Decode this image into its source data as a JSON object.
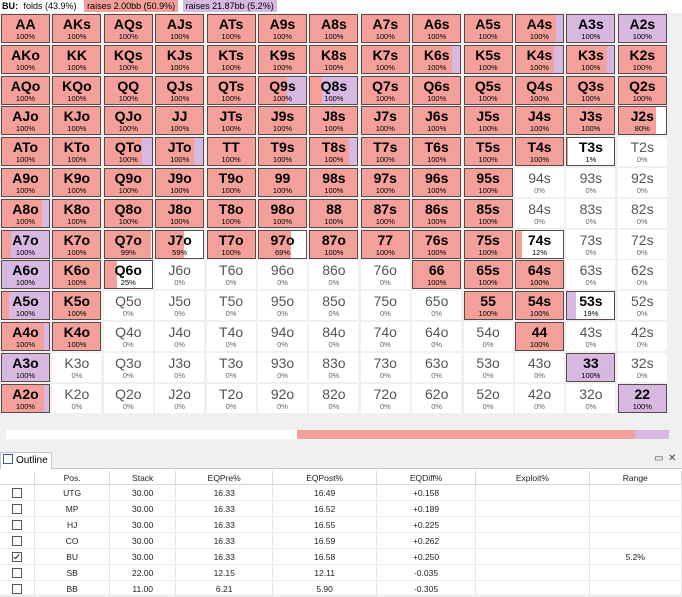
{
  "header": {
    "position": "BU:",
    "items": [
      {
        "label": "folds (43.9%)",
        "color": "#ffffff"
      },
      {
        "label": "raises 2.00bb (50.9%)",
        "color": "#f4a09a"
      },
      {
        "label": "raises 21.87bb (5.2%)",
        "color": "#d6b8e0"
      }
    ]
  },
  "colors": {
    "raise_small": "#f4a09a",
    "raise_allin": "#d6b8e0",
    "fold": "#ffffff"
  },
  "grid": [
    [
      {
        "c": "AA",
        "p": "100%",
        "r": 1,
        "a": 0
      },
      {
        "c": "AKs",
        "p": "100%",
        "r": 1,
        "a": 0
      },
      {
        "c": "AQs",
        "p": "100%",
        "r": 1,
        "a": 0
      },
      {
        "c": "AJs",
        "p": "100%",
        "r": 1,
        "a": 0
      },
      {
        "c": "ATs",
        "p": "100%",
        "r": 1,
        "a": 0
      },
      {
        "c": "A9s",
        "p": "100%",
        "r": 1,
        "a": 0
      },
      {
        "c": "A8s",
        "p": "100%",
        "r": 1,
        "a": 0
      },
      {
        "c": "A7s",
        "p": "100%",
        "r": 1,
        "a": 0
      },
      {
        "c": "A6s",
        "p": "100%",
        "r": 1,
        "a": 0
      },
      {
        "c": "A5s",
        "p": "100%",
        "r": 1,
        "a": 0
      },
      {
        "c": "A4s",
        "p": "100%",
        "r": 0.85,
        "a": 0.15
      },
      {
        "c": "A3s",
        "p": "100%",
        "r": 0,
        "a": 1
      },
      {
        "c": "A2s",
        "p": "100%",
        "r": 0,
        "a": 1
      }
    ],
    [
      {
        "c": "AKo",
        "p": "100%",
        "r": 1,
        "a": 0
      },
      {
        "c": "KK",
        "p": "100%",
        "r": 1,
        "a": 0
      },
      {
        "c": "KQs",
        "p": "100%",
        "r": 1,
        "a": 0
      },
      {
        "c": "KJs",
        "p": "100%",
        "r": 1,
        "a": 0
      },
      {
        "c": "KTs",
        "p": "100%",
        "r": 1,
        "a": 0
      },
      {
        "c": "K9s",
        "p": "100%",
        "r": 1,
        "a": 0
      },
      {
        "c": "K8s",
        "p": "100%",
        "r": 1,
        "a": 0
      },
      {
        "c": "K7s",
        "p": "100%",
        "r": 1,
        "a": 0
      },
      {
        "c": "K6s",
        "p": "100%",
        "r": 0.82,
        "a": 0.18
      },
      {
        "c": "K5s",
        "p": "100%",
        "r": 1,
        "a": 0
      },
      {
        "c": "K4s",
        "p": "100%",
        "r": 0.8,
        "a": 0.2
      },
      {
        "c": "K3s",
        "p": "100%",
        "r": 0.85,
        "a": 0.15
      },
      {
        "c": "K2s",
        "p": "100%",
        "r": 1,
        "a": 0
      }
    ],
    [
      {
        "c": "AQo",
        "p": "100%",
        "r": 1,
        "a": 0
      },
      {
        "c": "KQo",
        "p": "100%",
        "r": 1,
        "a": 0
      },
      {
        "c": "QQ",
        "p": "100%",
        "r": 1,
        "a": 0
      },
      {
        "c": "QJs",
        "p": "100%",
        "r": 1,
        "a": 0
      },
      {
        "c": "QTs",
        "p": "100%",
        "r": 1,
        "a": 0
      },
      {
        "c": "Q9s",
        "p": "100%",
        "r": 0.6,
        "a": 0.4
      },
      {
        "c": "Q8s",
        "p": "100%",
        "r": 0.25,
        "a": 0.75
      },
      {
        "c": "Q7s",
        "p": "100%",
        "r": 1,
        "a": 0
      },
      {
        "c": "Q6s",
        "p": "100%",
        "r": 1,
        "a": 0
      },
      {
        "c": "Q5s",
        "p": "100%",
        "r": 1,
        "a": 0
      },
      {
        "c": "Q4s",
        "p": "100%",
        "r": 1,
        "a": 0
      },
      {
        "c": "Q3s",
        "p": "100%",
        "r": 1,
        "a": 0
      },
      {
        "c": "Q2s",
        "p": "100%",
        "r": 1,
        "a": 0
      }
    ],
    [
      {
        "c": "AJo",
        "p": "100%",
        "r": 1,
        "a": 0
      },
      {
        "c": "KJo",
        "p": "100%",
        "r": 1,
        "a": 0
      },
      {
        "c": "QJo",
        "p": "100%",
        "r": 1,
        "a": 0
      },
      {
        "c": "JJ",
        "p": "100%",
        "r": 1,
        "a": 0
      },
      {
        "c": "JTs",
        "p": "100%",
        "r": 1,
        "a": 0
      },
      {
        "c": "J9s",
        "p": "100%",
        "r": 1,
        "a": 0
      },
      {
        "c": "J8s",
        "p": "100%",
        "r": 1,
        "a": 0
      },
      {
        "c": "J7s",
        "p": "100%",
        "r": 1,
        "a": 0
      },
      {
        "c": "J6s",
        "p": "100%",
        "r": 1,
        "a": 0
      },
      {
        "c": "J5s",
        "p": "100%",
        "r": 1,
        "a": 0
      },
      {
        "c": "J4s",
        "p": "100%",
        "r": 1,
        "a": 0
      },
      {
        "c": "J3s",
        "p": "100%",
        "r": 1,
        "a": 0
      },
      {
        "c": "J2s",
        "p": "80%",
        "r": 0.8,
        "a": 0
      }
    ],
    [
      {
        "c": "ATo",
        "p": "100%",
        "r": 1,
        "a": 0
      },
      {
        "c": "KTo",
        "p": "100%",
        "r": 1,
        "a": 0
      },
      {
        "c": "QTo",
        "p": "100%",
        "r": 0.8,
        "a": 0.2
      },
      {
        "c": "JTo",
        "p": "100%",
        "r": 0.8,
        "a": 0.2
      },
      {
        "c": "TT",
        "p": "100%",
        "r": 1,
        "a": 0
      },
      {
        "c": "T9s",
        "p": "100%",
        "r": 1,
        "a": 0
      },
      {
        "c": "T8s",
        "p": "100%",
        "r": 0.82,
        "a": 0.18
      },
      {
        "c": "T7s",
        "p": "100%",
        "r": 1,
        "a": 0
      },
      {
        "c": "T6s",
        "p": "100%",
        "r": 1,
        "a": 0
      },
      {
        "c": "T5s",
        "p": "100%",
        "r": 1,
        "a": 0
      },
      {
        "c": "T4s",
        "p": "100%",
        "r": 1,
        "a": 0
      },
      {
        "c": "T3s",
        "p": "1%",
        "r": 0.01,
        "a": 0
      },
      {
        "c": "T2s",
        "p": "0%",
        "r": 0,
        "a": 0
      }
    ],
    [
      {
        "c": "A9o",
        "p": "100%",
        "r": 1,
        "a": 0
      },
      {
        "c": "K9o",
        "p": "100%",
        "r": 1,
        "a": 0
      },
      {
        "c": "Q9o",
        "p": "100%",
        "r": 1,
        "a": 0
      },
      {
        "c": "J9o",
        "p": "100%",
        "r": 1,
        "a": 0
      },
      {
        "c": "T9o",
        "p": "100%",
        "r": 1,
        "a": 0
      },
      {
        "c": "99",
        "p": "100%",
        "r": 1,
        "a": 0
      },
      {
        "c": "98s",
        "p": "100%",
        "r": 1,
        "a": 0
      },
      {
        "c": "97s",
        "p": "100%",
        "r": 1,
        "a": 0
      },
      {
        "c": "96s",
        "p": "100%",
        "r": 1,
        "a": 0
      },
      {
        "c": "95s",
        "p": "100%",
        "r": 1,
        "a": 0
      },
      {
        "c": "94s",
        "p": "0%",
        "r": 0,
        "a": 0
      },
      {
        "c": "93s",
        "p": "0%",
        "r": 0,
        "a": 0
      },
      {
        "c": "92s",
        "p": "0%",
        "r": 0,
        "a": 0
      }
    ],
    [
      {
        "c": "A8o",
        "p": "100%",
        "r": 0.85,
        "a": 0.15
      },
      {
        "c": "K8o",
        "p": "100%",
        "r": 1,
        "a": 0
      },
      {
        "c": "Q8o",
        "p": "100%",
        "r": 1,
        "a": 0
      },
      {
        "c": "J8o",
        "p": "100%",
        "r": 1,
        "a": 0
      },
      {
        "c": "T8o",
        "p": "100%",
        "r": 1,
        "a": 0
      },
      {
        "c": "98o",
        "p": "100%",
        "r": 1,
        "a": 0
      },
      {
        "c": "88",
        "p": "100%",
        "r": 1,
        "a": 0
      },
      {
        "c": "87s",
        "p": "100%",
        "r": 1,
        "a": 0
      },
      {
        "c": "86s",
        "p": "100%",
        "r": 1,
        "a": 0
      },
      {
        "c": "85s",
        "p": "100%",
        "r": 1,
        "a": 0
      },
      {
        "c": "84s",
        "p": "0%",
        "r": 0,
        "a": 0
      },
      {
        "c": "83s",
        "p": "0%",
        "r": 0,
        "a": 0
      },
      {
        "c": "82s",
        "p": "0%",
        "r": 0,
        "a": 0
      }
    ],
    [
      {
        "c": "A7o",
        "p": "100%",
        "r": 0.2,
        "a": 0.8
      },
      {
        "c": "K7o",
        "p": "100%",
        "r": 1,
        "a": 0
      },
      {
        "c": "Q7o",
        "p": "99%",
        "r": 0.99,
        "a": 0
      },
      {
        "c": "J7o",
        "p": "59%",
        "r": 0.59,
        "a": 0
      },
      {
        "c": "T7o",
        "p": "100%",
        "r": 1,
        "a": 0
      },
      {
        "c": "97o",
        "p": "69%",
        "r": 0.69,
        "a": 0
      },
      {
        "c": "87o",
        "p": "100%",
        "r": 1,
        "a": 0
      },
      {
        "c": "77",
        "p": "100%",
        "r": 1,
        "a": 0
      },
      {
        "c": "76s",
        "p": "100%",
        "r": 1,
        "a": 0
      },
      {
        "c": "75s",
        "p": "100%",
        "r": 1,
        "a": 0
      },
      {
        "c": "74s",
        "p": "12%",
        "r": 0.12,
        "a": 0
      },
      {
        "c": "73s",
        "p": "0%",
        "r": 0,
        "a": 0
      },
      {
        "c": "72s",
        "p": "0%",
        "r": 0,
        "a": 0
      }
    ],
    [
      {
        "c": "A6o",
        "p": "100%",
        "r": 0,
        "a": 1
      },
      {
        "c": "K6o",
        "p": "100%",
        "r": 1,
        "a": 0
      },
      {
        "c": "Q6o",
        "p": "25%",
        "r": 0.25,
        "a": 0
      },
      {
        "c": "J6o",
        "p": "0%",
        "r": 0,
        "a": 0
      },
      {
        "c": "T6o",
        "p": "0%",
        "r": 0,
        "a": 0
      },
      {
        "c": "96o",
        "p": "0%",
        "r": 0,
        "a": 0
      },
      {
        "c": "86o",
        "p": "0%",
        "r": 0,
        "a": 0
      },
      {
        "c": "76o",
        "p": "0%",
        "r": 0,
        "a": 0
      },
      {
        "c": "66",
        "p": "100%",
        "r": 1,
        "a": 0
      },
      {
        "c": "65s",
        "p": "100%",
        "r": 1,
        "a": 0
      },
      {
        "c": "64s",
        "p": "100%",
        "r": 1,
        "a": 0
      },
      {
        "c": "63s",
        "p": "0%",
        "r": 0,
        "a": 0
      },
      {
        "c": "62s",
        "p": "0%",
        "r": 0,
        "a": 0
      }
    ],
    [
      {
        "c": "A5o",
        "p": "100%",
        "r": 0.15,
        "a": 0.85
      },
      {
        "c": "K5o",
        "p": "100%",
        "r": 1,
        "a": 0
      },
      {
        "c": "Q5o",
        "p": "0%",
        "r": 0,
        "a": 0
      },
      {
        "c": "J5o",
        "p": "0%",
        "r": 0,
        "a": 0
      },
      {
        "c": "T5o",
        "p": "0%",
        "r": 0,
        "a": 0
      },
      {
        "c": "95o",
        "p": "0%",
        "r": 0,
        "a": 0
      },
      {
        "c": "85o",
        "p": "0%",
        "r": 0,
        "a": 0
      },
      {
        "c": "75o",
        "p": "0%",
        "r": 0,
        "a": 0
      },
      {
        "c": "65o",
        "p": "0%",
        "r": 0,
        "a": 0
      },
      {
        "c": "55",
        "p": "100%",
        "r": 1,
        "a": 0
      },
      {
        "c": "54s",
        "p": "100%",
        "r": 1,
        "a": 0
      },
      {
        "c": "53s",
        "p": "19%",
        "r": 0,
        "a": 0.19
      },
      {
        "c": "52s",
        "p": "0%",
        "r": 0,
        "a": 0
      }
    ],
    [
      {
        "c": "A4o",
        "p": "100%",
        "r": 0.9,
        "a": 0.1
      },
      {
        "c": "K4o",
        "p": "100%",
        "r": 1,
        "a": 0
      },
      {
        "c": "Q4o",
        "p": "0%",
        "r": 0,
        "a": 0
      },
      {
        "c": "J4o",
        "p": "0%",
        "r": 0,
        "a": 0
      },
      {
        "c": "T4o",
        "p": "0%",
        "r": 0,
        "a": 0
      },
      {
        "c": "94o",
        "p": "0%",
        "r": 0,
        "a": 0
      },
      {
        "c": "84o",
        "p": "0%",
        "r": 0,
        "a": 0
      },
      {
        "c": "74o",
        "p": "0%",
        "r": 0,
        "a": 0
      },
      {
        "c": "64o",
        "p": "0%",
        "r": 0,
        "a": 0
      },
      {
        "c": "54o",
        "p": "0%",
        "r": 0,
        "a": 0
      },
      {
        "c": "44",
        "p": "100%",
        "r": 1,
        "a": 0
      },
      {
        "c": "43s",
        "p": "0%",
        "r": 0,
        "a": 0
      },
      {
        "c": "42s",
        "p": "0%",
        "r": 0,
        "a": 0
      }
    ],
    [
      {
        "c": "A3o",
        "p": "100%",
        "r": 0,
        "a": 1
      },
      {
        "c": "K3o",
        "p": "0%",
        "r": 0,
        "a": 0
      },
      {
        "c": "Q3o",
        "p": "0%",
        "r": 0,
        "a": 0
      },
      {
        "c": "J3o",
        "p": "0%",
        "r": 0,
        "a": 0
      },
      {
        "c": "T3o",
        "p": "0%",
        "r": 0,
        "a": 0
      },
      {
        "c": "93o",
        "p": "0%",
        "r": 0,
        "a": 0
      },
      {
        "c": "83o",
        "p": "0%",
        "r": 0,
        "a": 0
      },
      {
        "c": "73o",
        "p": "0%",
        "r": 0,
        "a": 0
      },
      {
        "c": "63o",
        "p": "0%",
        "r": 0,
        "a": 0
      },
      {
        "c": "53o",
        "p": "0%",
        "r": 0,
        "a": 0
      },
      {
        "c": "43o",
        "p": "0%",
        "r": 0,
        "a": 0
      },
      {
        "c": "33",
        "p": "100%",
        "r": 0,
        "a": 1
      },
      {
        "c": "32s",
        "p": "0%",
        "r": 0,
        "a": 0
      }
    ],
    [
      {
        "c": "A2o",
        "p": "100%",
        "r": 0.9,
        "a": 0.1
      },
      {
        "c": "K2o",
        "p": "0%",
        "r": 0,
        "a": 0
      },
      {
        "c": "Q2o",
        "p": "0%",
        "r": 0,
        "a": 0
      },
      {
        "c": "J2o",
        "p": "0%",
        "r": 0,
        "a": 0
      },
      {
        "c": "T2o",
        "p": "0%",
        "r": 0,
        "a": 0
      },
      {
        "c": "92o",
        "p": "0%",
        "r": 0,
        "a": 0
      },
      {
        "c": "82o",
        "p": "0%",
        "r": 0,
        "a": 0
      },
      {
        "c": "72o",
        "p": "0%",
        "r": 0,
        "a": 0
      },
      {
        "c": "62o",
        "p": "0%",
        "r": 0,
        "a": 0
      },
      {
        "c": "52o",
        "p": "0%",
        "r": 0,
        "a": 0
      },
      {
        "c": "42o",
        "p": "0%",
        "r": 0,
        "a": 0
      },
      {
        "c": "32o",
        "p": "0%",
        "r": 0,
        "a": 0
      },
      {
        "c": "22",
        "p": "100%",
        "r": 0,
        "a": 1
      }
    ]
  ],
  "summary_bar": {
    "fold": 0.439,
    "raise": 0.509,
    "allin": 0.052
  },
  "panel": {
    "tab_label": "Outline",
    "tab_icon": "outline-icon",
    "pin_glyph": "▭",
    "close_glyph": "✕",
    "columns": [
      "",
      "Pos.",
      "Stack",
      "EQPre%",
      "EQPost%",
      "EQDiff%",
      "Exploit%",
      "Range"
    ],
    "rows": [
      {
        "checked": false,
        "pos": "UTG",
        "stack": "30.00",
        "eqpre": "16.33",
        "eqpost": "16.49",
        "eqdiff": "+0.158",
        "exploit": "",
        "range": ""
      },
      {
        "checked": false,
        "pos": "MP",
        "stack": "30.00",
        "eqpre": "16.33",
        "eqpost": "16.52",
        "eqdiff": "+0.189",
        "exploit": "",
        "range": ""
      },
      {
        "checked": false,
        "pos": "HJ",
        "stack": "30.00",
        "eqpre": "16.33",
        "eqpost": "16.55",
        "eqdiff": "+0.225",
        "exploit": "",
        "range": ""
      },
      {
        "checked": false,
        "pos": "CO",
        "stack": "30.00",
        "eqpre": "16.33",
        "eqpost": "16.59",
        "eqdiff": "+0.262",
        "exploit": "",
        "range": ""
      },
      {
        "checked": true,
        "pos": "BU",
        "stack": "30.00",
        "eqpre": "16.33",
        "eqpost": "16.58",
        "eqdiff": "+0.250",
        "exploit": "",
        "range": "5.2%"
      },
      {
        "checked": false,
        "pos": "SB",
        "stack": "22.00",
        "eqpre": "12.15",
        "eqpost": "12.11",
        "eqdiff": "-0.035",
        "exploit": "",
        "range": ""
      },
      {
        "checked": false,
        "pos": "BB",
        "stack": "11.00",
        "eqpre": "6.21",
        "eqpost": "5.90",
        "eqdiff": "-0.305",
        "exploit": "",
        "range": ""
      }
    ]
  }
}
